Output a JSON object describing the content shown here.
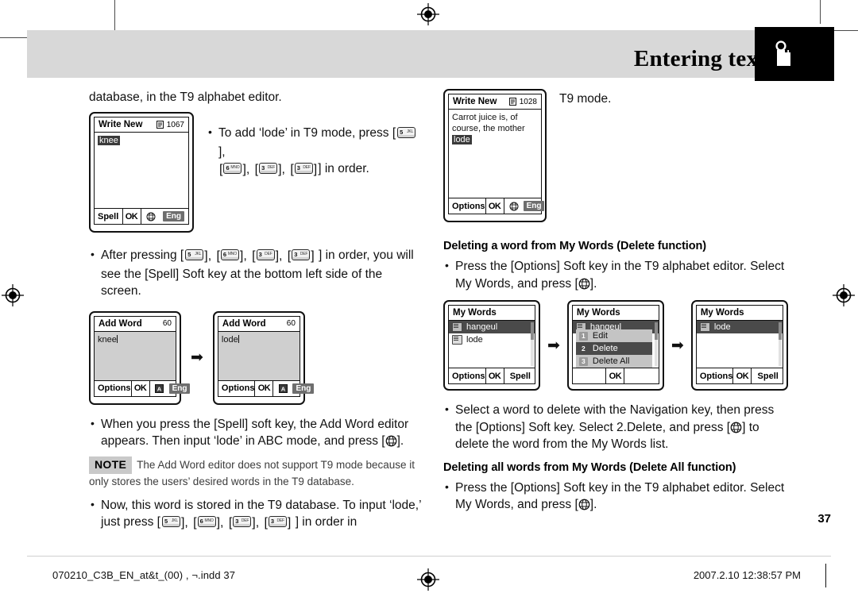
{
  "header": {
    "title": "Entering text",
    "tab_icon": "hand-pointer-icon"
  },
  "page_number": "37",
  "left_column": {
    "intro_text": "database, in the T9 alphabet editor.",
    "bullet_add_lode": {
      "pre": "To add ‘lode’ in T9 mode, press [",
      "post": "] in order.",
      "keys": [
        "5 JKL",
        "6 MNO",
        "3 DEF",
        "3 DEF"
      ]
    },
    "bullet_after_pressing": {
      "pre": "After pressing [",
      "post": "] in order, you will see the [Spell] Soft key at the bottom left side of the screen.",
      "keys": [
        "5 JKL",
        "6 MNO",
        "3 DEF",
        "3 DEF"
      ]
    },
    "bullet_spell_softkey": "When you press the [Spell] soft key, the Add Word editor appears. Then input ‘lode’ in ABC mode, and press [globe].",
    "note": {
      "tag": "NOTE",
      "text": "The Add Word editor does not support T9 mode because it only stores the users’ desired words in the T9 database."
    },
    "bullet_stored": {
      "pre": "Now, this word is stored in the T9 database. To input ‘lode,’ just press [",
      "post": "] in order in",
      "keys": [
        "5 JKL",
        "6 MNO",
        "3 DEF",
        "3 DEF"
      ]
    },
    "screen_write_new": {
      "title": "Write New",
      "counter": "1067",
      "counter_icon": "message-lines-icon",
      "body_text": "knee",
      "body_selected": true,
      "softkeys": {
        "left": "Spell",
        "center": "OK",
        "icon": "globe-icon",
        "right": "Eng"
      }
    },
    "screen_add_word_1": {
      "title": "Add Word",
      "counter": "60",
      "body_text": "knee",
      "softkeys": {
        "left": "Options",
        "center": "OK",
        "icon": "abc-mode-icon",
        "right": "Eng"
      }
    },
    "screen_add_word_2": {
      "title": "Add Word",
      "counter": "60",
      "body_text": "lode",
      "softkeys": {
        "left": "Options",
        "center": "OK",
        "icon": "abc-mode-icon",
        "right": "Eng"
      }
    }
  },
  "right_column": {
    "t9_mode_text": "T9 mode.",
    "screen_write_new_2": {
      "title": "Write New",
      "counter": "1028",
      "counter_icon": "message-lines-icon",
      "body_lines": [
        "Carrot juice is, of",
        "course, the mother"
      ],
      "body_highlighted_word": "lode",
      "softkeys": {
        "left": "Options",
        "center": "OK",
        "icon": "globe-icon",
        "right": "Eng"
      }
    },
    "heading_delete": "Deleting a word from My Words (Delete function)",
    "bullet_press_options_1": "Press the [Options] Soft key in the T9 alphabet editor. Select My Words, and press [globe].",
    "screen_my_words_1": {
      "title": "My Words",
      "items": [
        "hangeul",
        "lode"
      ],
      "selected_index": 0,
      "softkeys": {
        "left": "Options",
        "center": "OK",
        "right": "Spell"
      }
    },
    "screen_my_words_2": {
      "title": "My Words",
      "items": [
        "hangeul"
      ],
      "selected_index": 0,
      "menu": [
        {
          "num": "1",
          "label": "Edit",
          "selected": false
        },
        {
          "num": "2",
          "label": "Delete",
          "selected": true
        },
        {
          "num": "3",
          "label": "Delete All",
          "selected": false
        }
      ],
      "softkeys": {
        "left": "",
        "center": "OK",
        "right": ""
      }
    },
    "screen_my_words_3": {
      "title": "My Words",
      "items": [
        "lode"
      ],
      "selected_index": 0,
      "softkeys": {
        "left": "Options",
        "center": "OK",
        "right": "Spell"
      }
    },
    "bullet_select_word": "Select a word to delete with the Navigation key, then press the [Options] Soft key. Select 2.Delete, and press [globe] to delete the word from the My Words list.",
    "heading_delete_all": "Deleting all words from My Words (Delete All function)",
    "bullet_press_options_2": "Press the [Options] Soft key in the T9 alphabet editor. Select My Words, and press [globe]."
  },
  "footer": {
    "filename": "070210_C3B_EN_at&t_(00) , ¬.indd   37",
    "timestamp": "2007.2.10   12:38:57 PM"
  },
  "colors": {
    "header_band": "#d8d8d8",
    "header_tab": "#000000",
    "screen_grey": "#cfcfcf",
    "highlight": "#4a4a4a",
    "note_tag": "#c9c9c9"
  }
}
